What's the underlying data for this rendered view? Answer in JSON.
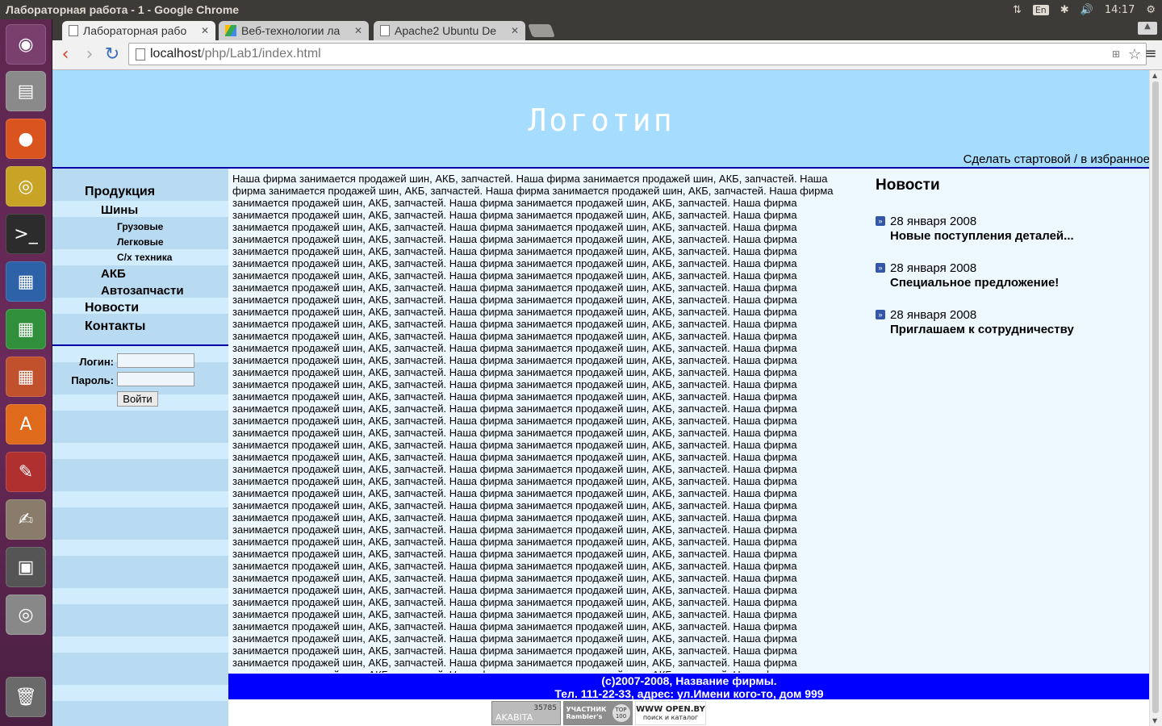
{
  "system": {
    "window_title": "Лабораторная работа - 1 - Google Chrome",
    "keyboard_layout": "En",
    "clock": "14:17",
    "icons": [
      "network-updown-icon",
      "keyboard-layout-icon",
      "bluetooth-icon",
      "volume-icon",
      "power-gear-icon"
    ]
  },
  "launcher": {
    "items": [
      "ubuntu-dash-icon",
      "files-icon",
      "firefox-icon",
      "chrome-icon",
      "terminal-icon",
      "writer-icon",
      "calc-icon",
      "impress-icon",
      "software-center-icon",
      "system-settings-icon",
      "text-editor-icon",
      "floppy-icon",
      "dvd-icon",
      "trash-icon"
    ],
    "colors": {
      "background": "#5e2750"
    }
  },
  "browser": {
    "tabs": [
      {
        "label": "Лабораторная рабо",
        "icon": "page-icon",
        "active": true
      },
      {
        "label": "Веб-технологии ла",
        "icon": "google-drive-icon",
        "active": false
      },
      {
        "label": "Apache2 Ubuntu De",
        "icon": "page-icon",
        "active": false
      }
    ],
    "url_host": "localhost",
    "url_path": "/php/Lab1/index.html"
  },
  "page": {
    "logo": "Логотип",
    "favorites_link": "Сделать стартовой / в избранное",
    "nav": {
      "products": "Продукция",
      "tires": "Шины",
      "trucks": "Грузовые",
      "cars": "Легковые",
      "agri": "С/х техника",
      "batteries": "АКБ",
      "autoparts": "Автозапчасти",
      "news": "Новости",
      "contacts": "Контакты"
    },
    "login": {
      "login_label": "Логин:",
      "password_label": "Пароль:",
      "login_value": "",
      "password_value": "",
      "submit": "Войти"
    },
    "main_text": "Наша фирма занимается продажей шин, АКБ, запчастей. Наша фирма занимается продажей шин, АКБ, запчастей. Наша фирма занимается продажей шин, АКБ, запчастей. Наша фирма занимается продажей шин, АКБ, запчастей. Наша фирма занимается продажей шин, АКБ, запчастей. Наша фирма занимается продажей шин, АКБ, запчастей. Наша фирма занимается продажей шин, АКБ, запчастей. Наша фирма занимается продажей шин, АКБ, запчастей. Наша фирма занимается продажей шин, АКБ, запчастей. Наша фирма занимается продажей шин, АКБ, запчастей. Наша фирма занимается продажей шин, АКБ, запчастей. Наша фирма занимается продажей шин, АКБ, запчастей. Наша фирма занимается продажей шин, АКБ, запчастей. Наша фирма занимается продажей шин, АКБ, запчастей. Наша фирма занимается продажей шин, АКБ, запчастей. Наша фирма занимается продажей шин, АКБ, запчастей. Наша фирма занимается продажей шин, АКБ, запчастей. Наша фирма занимается продажей шин, АКБ, запчастей. Наша фирма занимается продажей шин, АКБ, запчастей. Наша фирма занимается продажей шин, АКБ, запчастей. Наша фирма занимается продажей шин, АКБ, запчастей. Наша фирма занимается продажей шин, АКБ, запчастей. Наша фирма занимается продажей шин, АКБ, запчастей. Наша фирма занимается продажей шин, АКБ, запчастей. Наша фирма занимается продажей шин, АКБ, запчастей. Наша фирма занимается продажей шин, АКБ, запчастей. Наша фирма занимается продажей шин, АКБ, запчастей. Наша фирма занимается продажей шин, АКБ, запчастей. Наша фирма занимается продажей шин, АКБ, запчастей. Наша фирма занимается продажей шин, АКБ, запчастей. Наша фирма занимается продажей шин, АКБ, запчастей. Наша фирма занимается продажей шин, АКБ, запчастей. Наша фирма занимается продажей шин, АКБ, запчастей. Наша фирма занимается продажей шин, АКБ, запчастей. Наша фирма занимается продажей шин, АКБ, запчастей. Наша фирма занимается продажей шин, АКБ, запчастей. Наша фирма занимается продажей шин, АКБ, запчастей. Наша фирма занимается продажей шин, АКБ, запчастей. Наша фирма занимается продажей шин, АКБ, запчастей. Наша фирма занимается продажей шин, АКБ, запчастей. Наша фирма занимается продажей шин, АКБ, запчастей. Наша фирма занимается продажей шин, АКБ, запчастей. Наша фирма занимается продажей шин, АКБ, запчастей. Наша фирма занимается продажей шин, АКБ, запчастей. Наша фирма занимается продажей шин, АКБ, запчастей. Наша фирма занимается продажей шин, АКБ, запчастей. Наша фирма занимается продажей шин, АКБ, запчастей. Наша фирма занимается продажей шин, АКБ, запчастей. Наша фирма занимается продажей шин, АКБ, запчастей. Наша фирма занимается продажей шин, АКБ, запчастей. Наша фирма занимается продажей шин, АКБ, запчастей. Наша фирма занимается продажей шин, АКБ, запчастей. Наша фирма занимается продажей шин, АКБ, запчастей. Наша фирма занимается продажей шин, АКБ, запчастей. Наша фирма занимается продажей шин, АКБ, запчастей. Наша фирма занимается продажей шин, АКБ, запчастей. Наша фирма занимается продажей шин, АКБ, запчастей. Наша фирма занимается продажей шин, АКБ, запчастей. Наша фирма занимается продажей шин, АКБ, запчастей. Наша фирма занимается продажей шин, АКБ, запчастей. Наша фирма занимается продажей шин, АКБ, запчастей. Наша фирма занимается продажей шин, АКБ, запчастей. Наша фирма занимается продажей шин, АКБ, запчастей. Наша фирма занимается продажей шин, АКБ, запчастей. Наша фирма занимается продажей шин, АКБ, запчастей. Наша фирма занимается продажей шин, АКБ, запчастей. Наша фирма занимается продажей шин, АКБ, запчастей. Наша фирма занимается продажей шин, АКБ, запчастей. Наша фирма занимается продажей шин, АКБ, запчастей. Наша фирма занимается продажей шин, АКБ, запчастей. Наша фирма занимается продажей шин, АКБ, запчастей. Наша фирма занимается продажей шин, АКБ, запчастей. Наша фирма занимается продажей шин, АКБ, запчастей. Наша фирма занимается продажей шин, АКБ, запчастей. Наша фирма занимается продажей шин, АКБ, запчастей. Наша фирма занимается продажей шин, АКБ, запчастей. Наша фирма занимается продажей шин, АКБ, запчастей. Наша фирма занимается продажей шин, АКБ, запчастей. Наша фирма занимается продажей шин, АКБ, запчастей. Наша фирма занимается продажей шин, АКБ, запчастей. Наша фирма занимается продажей шин, АКБ, запчастей. Наша фирма занимается продажей шин, АКБ, запчастей. Наша фирма занимается продажей шин, АКБ, запчастей. Наша фирма занимается продажей шин, АКБ, запчастей. Наша фирма занимается продажей шин, АКБ, запчастей. Наша фирма занимается продажей шин, АКБ, запчастей. Наша фирма занимается продажей шин, АКБ, запчастей. Наша фирма занимается продажей шин, АКБ, запчастей. Наша фирма занимается продажей шин, АКБ, запчастей. Наша фирма занимается продажей шин, АКБ, запчастей. Наша фирма занимается продажей шин, АКБ, запчастей. Наша фирма занимается продажей шин, АКБ, запчастей. Наша фирма занимается продажей шин, АКБ, запчастей. Наша фирма занимается продажей шин, АКБ, запчастей. Наша фирма занимается продажей шин, АКБ, запчастей. Наша фирма занимается продажей шин, АКБ, запчастей. Наша фирма занимается продажей шин, АКБ, запчастей. Наша фирма занимается продажей шин, АКБ, запчастей. Наша фирма занимается продажей шин, АКБ, запчастей. Наша фирма занимается продажей шин, АКБ, запчастей.",
    "news": {
      "heading": "Новости",
      "items": [
        {
          "date": "28 января 2008",
          "title": "Новые поступления деталей..."
        },
        {
          "date": "28 января 2008",
          "title": "Специальное предложение!"
        },
        {
          "date": "28 января 2008",
          "title": "Приглашаем к сотрудничеству"
        }
      ]
    },
    "footer": {
      "line1": "(c)2007-2008, Название фирмы.",
      "line2": "Тел. 111-22-33, адрес: ул.Имени кого-то, дом 999"
    },
    "counters": {
      "akavita_count": "35785",
      "akavita_label": "AKABITA",
      "rambler_label": "УЧАСТНИК Rambler's",
      "rambler_top": "TOP 100",
      "openby_label": "WWW OPEN.BY",
      "openby_sub": "поиск и каталог"
    },
    "colors": {
      "header_bg": "#a6dcfe",
      "divider": "#0000a8",
      "content_bg": "#eef8ff",
      "footer_bg": "#0000ff"
    }
  }
}
